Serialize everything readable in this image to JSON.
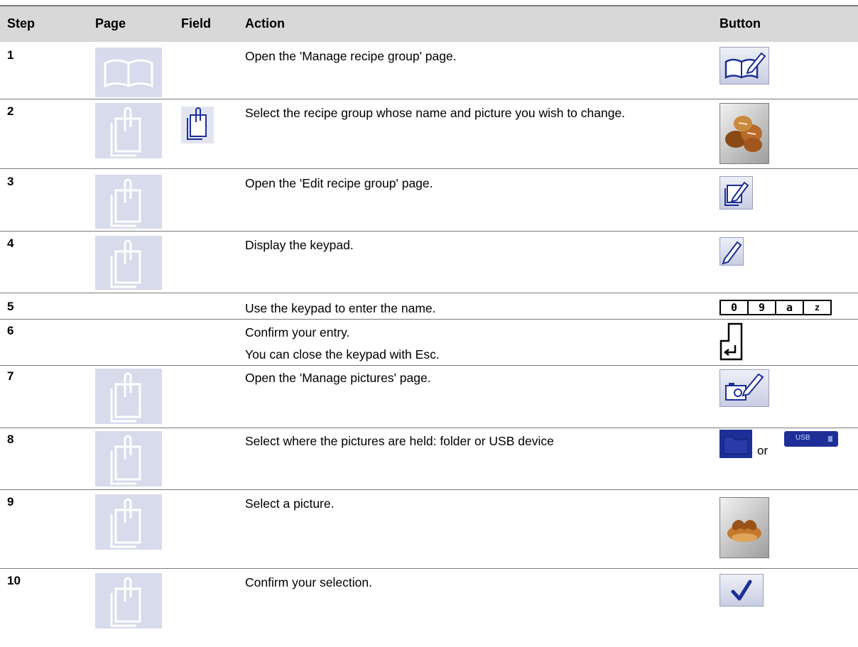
{
  "headers": {
    "step": "Step",
    "page": "Page",
    "field": "Field",
    "action": "Action",
    "button": "Button"
  },
  "rows": [
    {
      "step": "1",
      "action": "Open the 'Manage recipe group' page.",
      "page_icon": "book-icon",
      "button_icon": "book-edit-icon"
    },
    {
      "step": "2",
      "action": "Select the recipe group whose name and picture you wish to change.",
      "page_icon": "clipboard-icon",
      "field_icon": "clipboard-icon",
      "button_icon": "bread-rolls-icon"
    },
    {
      "step": "3",
      "action": "Open the 'Edit recipe group' page.",
      "page_icon": "clipboard-icon",
      "button_icon": "clipboard-edit-icon"
    },
    {
      "step": "4",
      "action": "Display the keypad.",
      "page_icon": "clipboard-icon",
      "button_icon": "pencil-icon"
    },
    {
      "step": "5",
      "action": "Use the keypad to enter the name.",
      "button_keys": [
        "0",
        "9",
        "a",
        "z"
      ]
    },
    {
      "step": "6",
      "action": "Confirm your entry.",
      "action_note": "You can close the keypad with Esc.",
      "button_icon": "enter-key-icon"
    },
    {
      "step": "7",
      "action": "Open the 'Manage pictures' page.",
      "page_icon": "clipboard-icon",
      "button_icon": "camera-edit-icon"
    },
    {
      "step": "8",
      "action": "Select where the pictures are held: folder or USB device",
      "page_icon": "clipboard-icon",
      "button_icon": "folder-icon",
      "button_or": "or",
      "button_icon_2": "usb-icon",
      "usb_label": "USB"
    },
    {
      "step": "9",
      "action": "Select a picture.",
      "page_icon": "clipboard-icon",
      "button_icon": "pretzel-bread-icon"
    },
    {
      "step": "10",
      "action": "Confirm your selection.",
      "page_icon": "clipboard-icon",
      "button_icon": "checkmark-icon"
    }
  ],
  "colors": {
    "icon_background": "#d8dbec",
    "header_background": "#d8d8d8",
    "button_blue": "#1d2f97"
  }
}
